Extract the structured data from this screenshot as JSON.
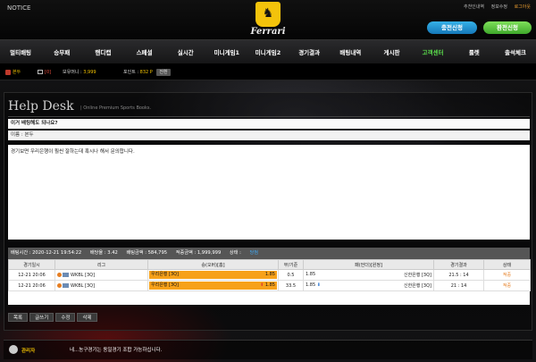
{
  "header": {
    "notice": "NOTICE",
    "logo_text": "Ferrari",
    "links": [
      "추천인내역",
      "정보수정",
      "로그아웃"
    ],
    "charge_button": "충전신청",
    "exchange_button": "환전신청"
  },
  "nav": {
    "items": [
      "멀티배팅",
      "승무패",
      "핸디캡",
      "스페셜",
      "실시간",
      "미니게임1",
      "미니게임2",
      "경기결과",
      "배팅내역",
      "게시판",
      "고객센터",
      "룰렛",
      "출석체크"
    ],
    "active_index": 10
  },
  "userbar": {
    "username": "본두",
    "messages": "[0]",
    "money_label": "보유머니 :",
    "money_value": "3,999",
    "points_label": "포인트 :",
    "points_value": "832 P",
    "convert_button": "전환"
  },
  "helpdesk": {
    "title": "Help Desk",
    "subtitle": "| Online Premium Sports Books.",
    "subject": "이거 배팅해도 되나요?",
    "author_label": "이름 : 본두",
    "body": "경기보면 우리은행이 훨씬 잘하는데 혹시나 해서 문의합니다."
  },
  "bet": {
    "summary": {
      "time": "배팅시간 : 2020-12-21 19:54:22",
      "odds": "배당율 : 3.42",
      "amount": "배팅금액 : 584,795",
      "win_amount": "적중금액 : 1,999,999",
      "status_label": "상태 :",
      "status_value": "당첨"
    },
    "columns": [
      "경기일시",
      "리그",
      "승(오버)[홈]",
      "무/기준",
      "패(언더)[원정]",
      "경기결과",
      "상태"
    ],
    "rows": [
      {
        "date": "12-21 20:06",
        "league": "WKBL [3Q]",
        "home": "우리은행 [3Q]",
        "home_odds": "1.85",
        "line": "0.5",
        "away_odds": "1.85",
        "away": "신한은행 [3Q]",
        "result": "21.5 : 14",
        "status": "적중",
        "home_arrow": "",
        "away_arrow": ""
      },
      {
        "date": "12-21 20:06",
        "league": "WKBL [3Q]",
        "home": "우리은행 [3Q]",
        "home_odds": "1.85",
        "line": "33.5",
        "away_odds": "1.85",
        "away": "신한은행 [3Q]",
        "result": "21 : 14",
        "status": "적중",
        "home_arrow": "⬆",
        "away_arrow": "⬇"
      }
    ]
  },
  "buttons": {
    "list": "목록",
    "write": "글쓰기",
    "edit": "수정",
    "delete": "삭제"
  },
  "reply": {
    "name": "관리자",
    "text": "네...농구경기는 동일경기 조합 가능하십니다."
  }
}
